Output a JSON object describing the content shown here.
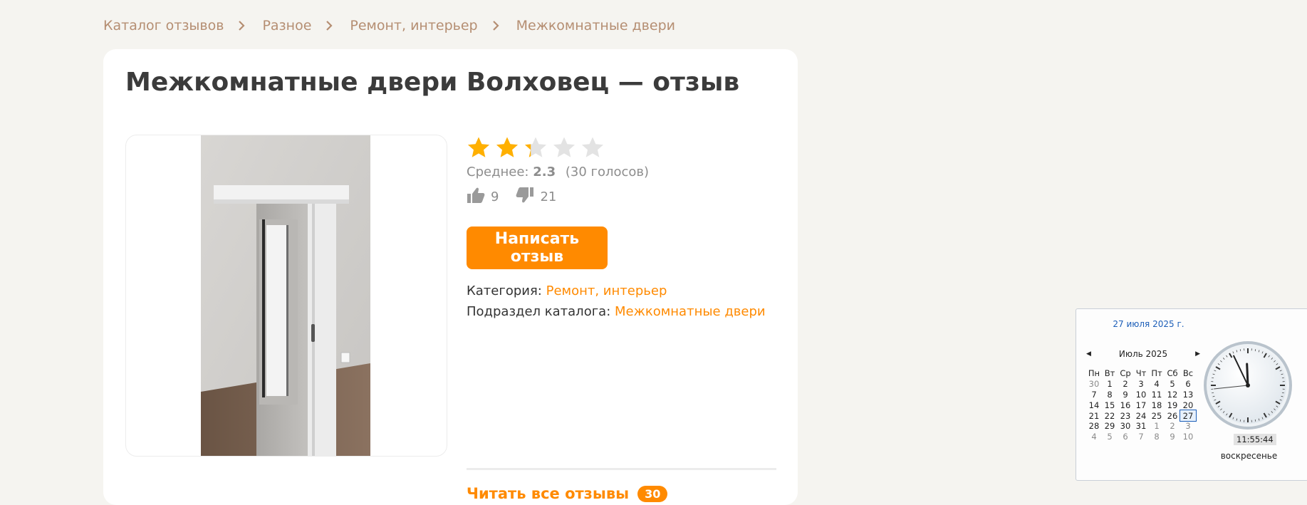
{
  "breadcrumb": {
    "items": [
      "Каталог отзывов",
      "Разное",
      "Ремонт, интерьер",
      "Межкомнатные двери"
    ]
  },
  "product": {
    "title": "Межкомнатные двери Волховец — отзыв",
    "rating": 2.3,
    "stars_max": 5,
    "average_label": "Среднее:",
    "average_value": "2.3",
    "votes_text": "(30 голосов)",
    "likes": "9",
    "dislikes": "21",
    "write_button": "Написать отзыв",
    "category_label": "Категория:",
    "category_value": "Ремонт, интерьер",
    "subsection_label": "Подраздел каталога:",
    "subsection_value": "Межкомнатные двери",
    "read_all_label": "Читать все отзывы",
    "read_all_count": "30"
  },
  "colors": {
    "accent": "#ff8a00",
    "star_filled": "#ffb000",
    "star_empty": "#e3e3e3",
    "breadcrumb": "#b58e72"
  },
  "clock_widget": {
    "date_title": "27 июля 2025 г.",
    "month_label": "Июль 2025",
    "weekdays": [
      "Пн",
      "Вт",
      "Ср",
      "Чт",
      "Пт",
      "Сб",
      "Вс"
    ],
    "weeks": [
      [
        "30",
        "1",
        "2",
        "3",
        "4",
        "5",
        "6"
      ],
      [
        "7",
        "8",
        "9",
        "10",
        "11",
        "12",
        "13"
      ],
      [
        "14",
        "15",
        "16",
        "17",
        "18",
        "19",
        "20"
      ],
      [
        "21",
        "22",
        "23",
        "24",
        "25",
        "26",
        "27"
      ],
      [
        "28",
        "29",
        "30",
        "31",
        "1",
        "2",
        "3"
      ],
      [
        "4",
        "5",
        "6",
        "7",
        "8",
        "9",
        "10"
      ]
    ],
    "today": "27",
    "time": "11:55:44",
    "day_name": "воскресенье"
  }
}
